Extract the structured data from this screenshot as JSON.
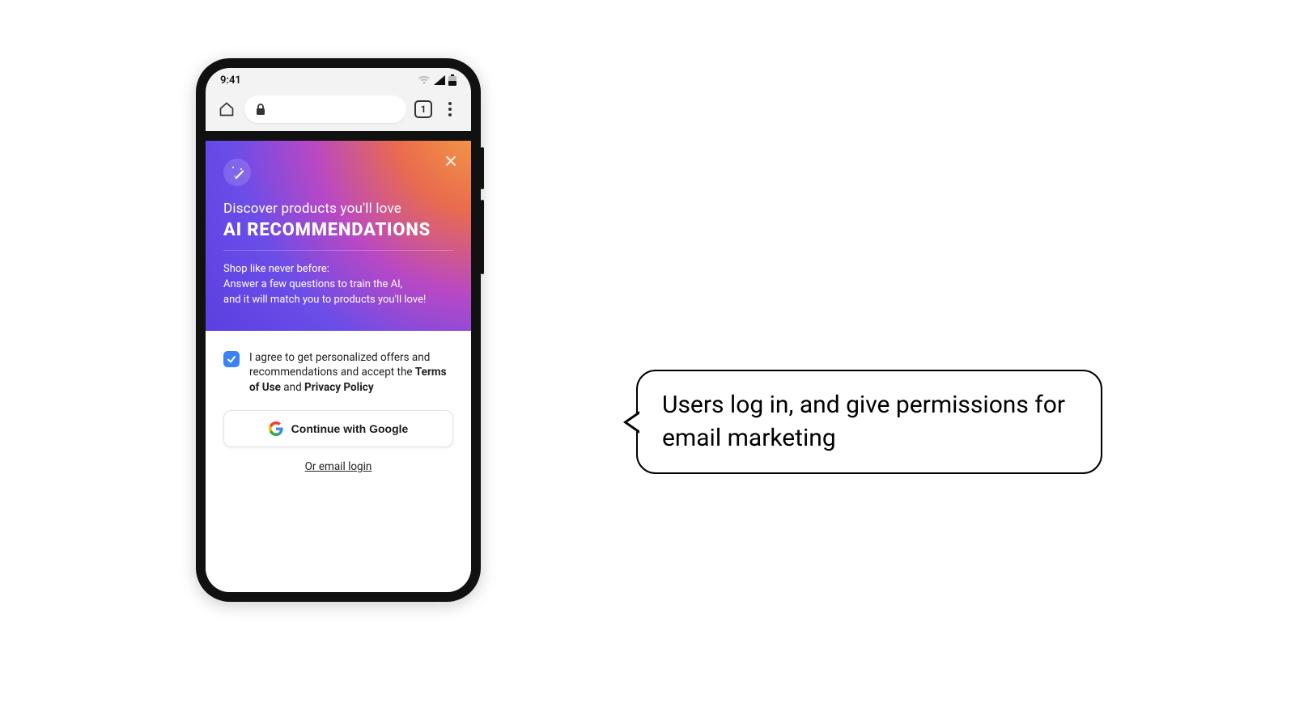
{
  "status": {
    "time": "9:41"
  },
  "browser": {
    "tab_count": "1"
  },
  "hero": {
    "subheading": "Discover products you'll love",
    "title": "AI RECOMMENDATIONS",
    "body_line1": "Shop like never before:",
    "body_line2": "Answer a few questions to train the AI,",
    "body_line3": "and it will match you to products you'll love!"
  },
  "auth": {
    "consent_prefix": "I agree to get personalized offers and recommendations and accept the ",
    "terms_label": "Terms of Use",
    "and_label": " and ",
    "privacy_label": "Privacy Policy",
    "google_button": "Continue with Google",
    "email_login": "Or email login"
  },
  "annotation": {
    "text": "Users log in, and give permissions for email marketing"
  }
}
